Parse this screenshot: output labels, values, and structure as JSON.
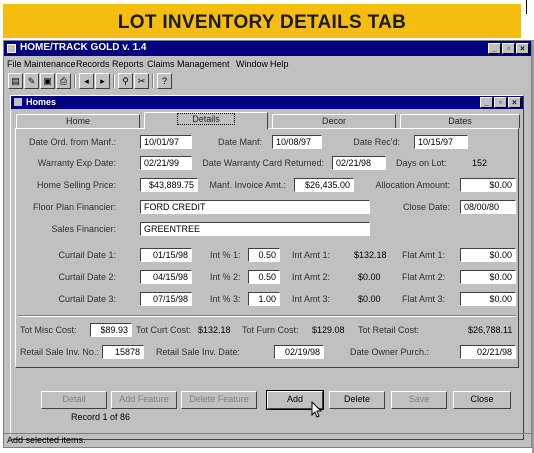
{
  "banner": {
    "title": "LOT INVENTORY DETAILS TAB"
  },
  "window": {
    "title": "HOME/TRACK GOLD v. 1.4"
  },
  "window_buttons": {
    "minimize": "_",
    "maximize": "▫",
    "close": "×"
  },
  "menu": [
    "File",
    "Maintenance",
    "Records",
    "Reports",
    "Claims",
    "Management",
    "Window",
    "Help"
  ],
  "child": {
    "title": "Homes"
  },
  "tabs": [
    "Home",
    "Details",
    "Decor",
    "Dates"
  ],
  "active_tab": "Details",
  "details": {
    "date_ord_label": "Date Ord. from Manf.:",
    "date_ord": "10/01/97",
    "date_manf_label": "Date Manf:",
    "date_manf": "10/08/97",
    "date_recd_label": "Date Rec'd:",
    "date_recd": "10/15/97",
    "warranty_exp_label": "Warranty Exp Date:",
    "warranty_exp": "02/21/99",
    "warranty_card_label": "Date Warranty Card Returned:",
    "warranty_card": "02/21/98",
    "days_on_lot_label": "Days on Lot:",
    "days_on_lot": "152",
    "selling_price_label": "Home Selling Price:",
    "selling_price": "$43,889.75",
    "manf_invoice_label": "Manf. Invoice Amt.:",
    "manf_invoice": "$26,435.00",
    "allocation_label": "Allocation Amount:",
    "allocation": "$0.00",
    "floor_plan_label": "Floor Plan Financier:",
    "floor_plan": "FORD CREDIT",
    "close_date_label": "Close Date:",
    "close_date": "08/00/80",
    "sales_financier_label": "Sales Financier:",
    "sales_financier": "GREENTREE"
  },
  "curtail": [
    {
      "date_label": "Curtail Date 1:",
      "date": "01/15/98",
      "int_label": "Int % 1:",
      "int": "0.50",
      "amt_label": "Int Amt 1:",
      "amt": "$132.18",
      "flat_label": "Flat Amt 1:",
      "flat": "$0.00"
    },
    {
      "date_label": "Curtail Date 2:",
      "date": "04/15/98",
      "int_label": "Int % 2:",
      "int": "0.50",
      "amt_label": "Int Amt 2:",
      "amt": "$0.00",
      "flat_label": "Flat Amt 2:",
      "flat": "$0.00"
    },
    {
      "date_label": "Curtail Date 3:",
      "date": "07/15/98",
      "int_label": "Int % 3:",
      "int": "1.00",
      "amt_label": "Int Amt 3:",
      "amt": "$0.00",
      "flat_label": "Flat Amt 3:",
      "flat": "$0.00"
    }
  ],
  "totals": {
    "misc_label": "Tot Misc Cost:",
    "misc": "$89.93",
    "curt_label": "Tot Curt Cost:",
    "curt": "$132.18",
    "furn_label": "Tot Furn Cost:",
    "furn": "$129.08",
    "retail_label": "Tot Retail Cost:",
    "retail": "$26,788.11",
    "sale_inv_label": "Retail Sale Inv. No.:",
    "sale_inv": "15878",
    "sale_inv_date_label": "Retail Sale Inv. Date:",
    "sale_inv_date": "02/19/98",
    "owner_purch_label": "Date Owner Purch.:",
    "owner_purch": "02/21/98"
  },
  "buttons": [
    "Detail",
    "Add Feature",
    "Delete Feature",
    "Add",
    "Delete",
    "Save",
    "Close"
  ],
  "record": "Record 1 of 86",
  "status": "Add selected items.",
  "colors": {
    "banner": "#f5bd10",
    "titlebar": "#000080",
    "face": "#c0c0c0"
  }
}
